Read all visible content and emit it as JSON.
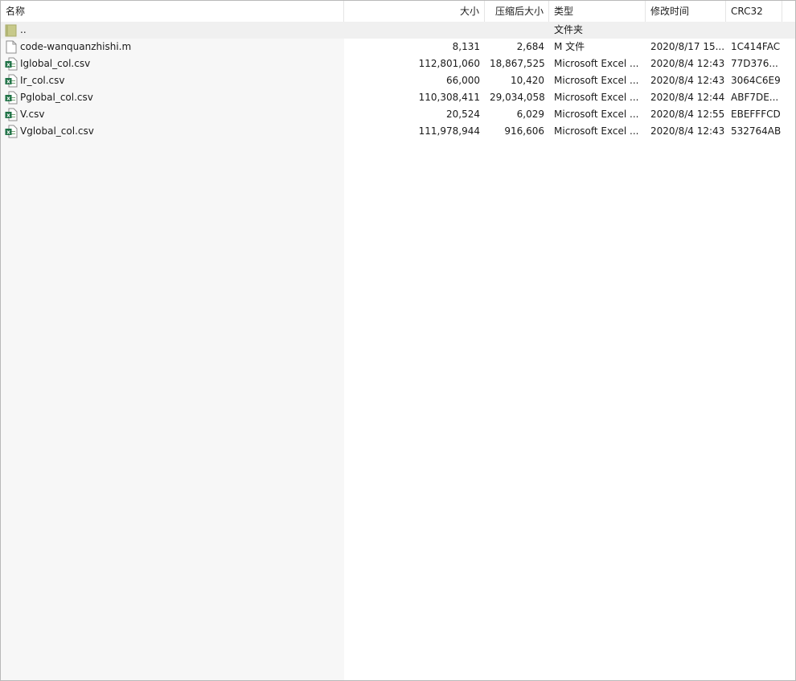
{
  "columns": {
    "name": "名称",
    "size": "大小",
    "packed": "压缩后大小",
    "type": "类型",
    "modified": "修改时间",
    "crc": "CRC32"
  },
  "rows": [
    {
      "name": "..",
      "size": "",
      "packed": "",
      "type": "文件夹",
      "modified": "",
      "crc": "",
      "icon": "folder-icon"
    },
    {
      "name": "code-wanquanzhishi.m",
      "size": "8,131",
      "packed": "2,684",
      "type": "M 文件",
      "modified": "2020/8/17 15...",
      "crc": "1C414FAC",
      "icon": "file-icon"
    },
    {
      "name": "Iglobal_col.csv",
      "size": "112,801,060",
      "packed": "18,867,525",
      "type": "Microsoft Excel ...",
      "modified": "2020/8/4 12:43",
      "crc": "77D376...",
      "icon": "excel-icon"
    },
    {
      "name": "Ir_col.csv",
      "size": "66,000",
      "packed": "10,420",
      "type": "Microsoft Excel ...",
      "modified": "2020/8/4 12:43",
      "crc": "3064C6E9",
      "icon": "excel-icon"
    },
    {
      "name": "Pglobal_col.csv",
      "size": "110,308,411",
      "packed": "29,034,058",
      "type": "Microsoft Excel ...",
      "modified": "2020/8/4 12:44",
      "crc": "ABF7DE...",
      "icon": "excel-icon"
    },
    {
      "name": "V.csv",
      "size": "20,524",
      "packed": "6,029",
      "type": "Microsoft Excel ...",
      "modified": "2020/8/4 12:55",
      "crc": "EBEFFFCD",
      "icon": "excel-icon"
    },
    {
      "name": "Vglobal_col.csv",
      "size": "111,978,944",
      "packed": "916,606",
      "type": "Microsoft Excel ...",
      "modified": "2020/8/4 12:43",
      "crc": "532764AB",
      "icon": "excel-icon"
    }
  ],
  "sort": {
    "column": "name",
    "direction": "ascending",
    "indicator": "^"
  }
}
